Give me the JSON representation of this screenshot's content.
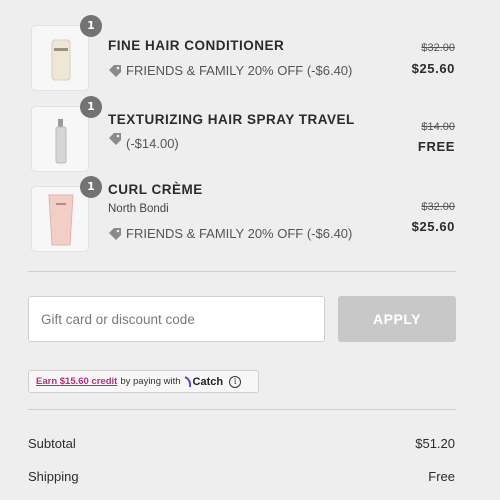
{
  "items": [
    {
      "quantity": "1",
      "name": "FINE HAIR CONDITIONER",
      "variant": "",
      "discount": "FRIENDS & FAMILY 20% OFF (-$6.40)",
      "original_price": "$32.00",
      "price": "$25.60",
      "thumb_color": "#ece6da"
    },
    {
      "quantity": "1",
      "name": "TEXTURIZING HAIR SPRAY TRAVEL",
      "variant": "",
      "discount": "(-$14.00)",
      "original_price": "$14.00",
      "price": "FREE",
      "thumb_color": "#d9d9d9"
    },
    {
      "quantity": "1",
      "name": "CURL CRÈME",
      "variant": "North Bondi",
      "discount": "FRIENDS & FAMILY 20% OFF (-$6.40)",
      "original_price": "$32.00",
      "price": "$25.60",
      "thumb_color": "#f0cfc6"
    }
  ],
  "discount_code": {
    "placeholder": "Gift card or discount code",
    "value": "",
    "apply_label": "APPLY"
  },
  "catch": {
    "link_text": "Earn $15.60 credit",
    "middle_text": "by paying with",
    "brand": "Catch",
    "info_glyph": "i",
    "link_color": "#c02a7a"
  },
  "summary": {
    "subtotal_label": "Subtotal",
    "subtotal_value": "$51.20",
    "shipping_label": "Shipping",
    "shipping_value": "Free"
  },
  "colors": {
    "background": "#eeeeee",
    "apply_disabled": "#c8c8c8",
    "qty_badge": "#737373",
    "divider": "#dcc9cf"
  }
}
